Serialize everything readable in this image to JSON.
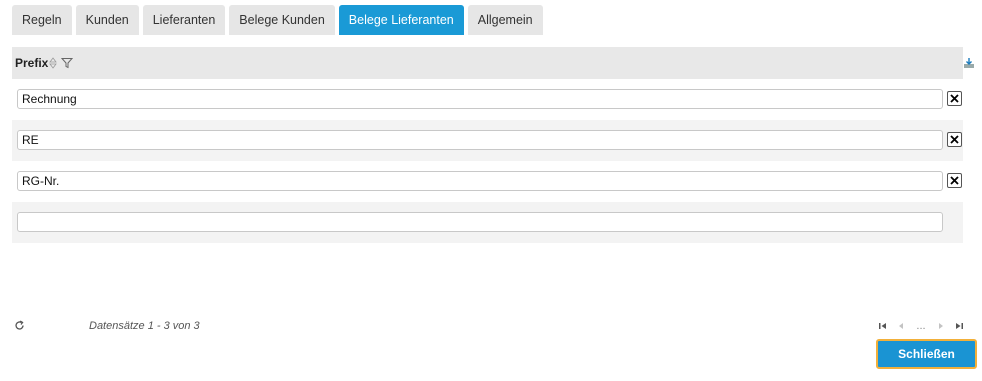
{
  "tabs": [
    {
      "label": "Regeln"
    },
    {
      "label": "Kunden"
    },
    {
      "label": "Lieferanten"
    },
    {
      "label": "Belege Kunden"
    },
    {
      "label": "Belege Lieferanten",
      "active": true
    },
    {
      "label": "Allgemein"
    }
  ],
  "grid": {
    "column_header": "Prefix",
    "rows": [
      {
        "value": "Rechnung"
      },
      {
        "value": "RE"
      },
      {
        "value": "RG-Nr."
      }
    ],
    "new_row_value": ""
  },
  "footer": {
    "record_count": "Datensätze 1 - 3 von 3",
    "pager_ellipsis": "..."
  },
  "buttons": {
    "close_label": "Schließen"
  },
  "colors": {
    "accent": "#1a9ad6",
    "focus_border": "#f2b03a"
  }
}
